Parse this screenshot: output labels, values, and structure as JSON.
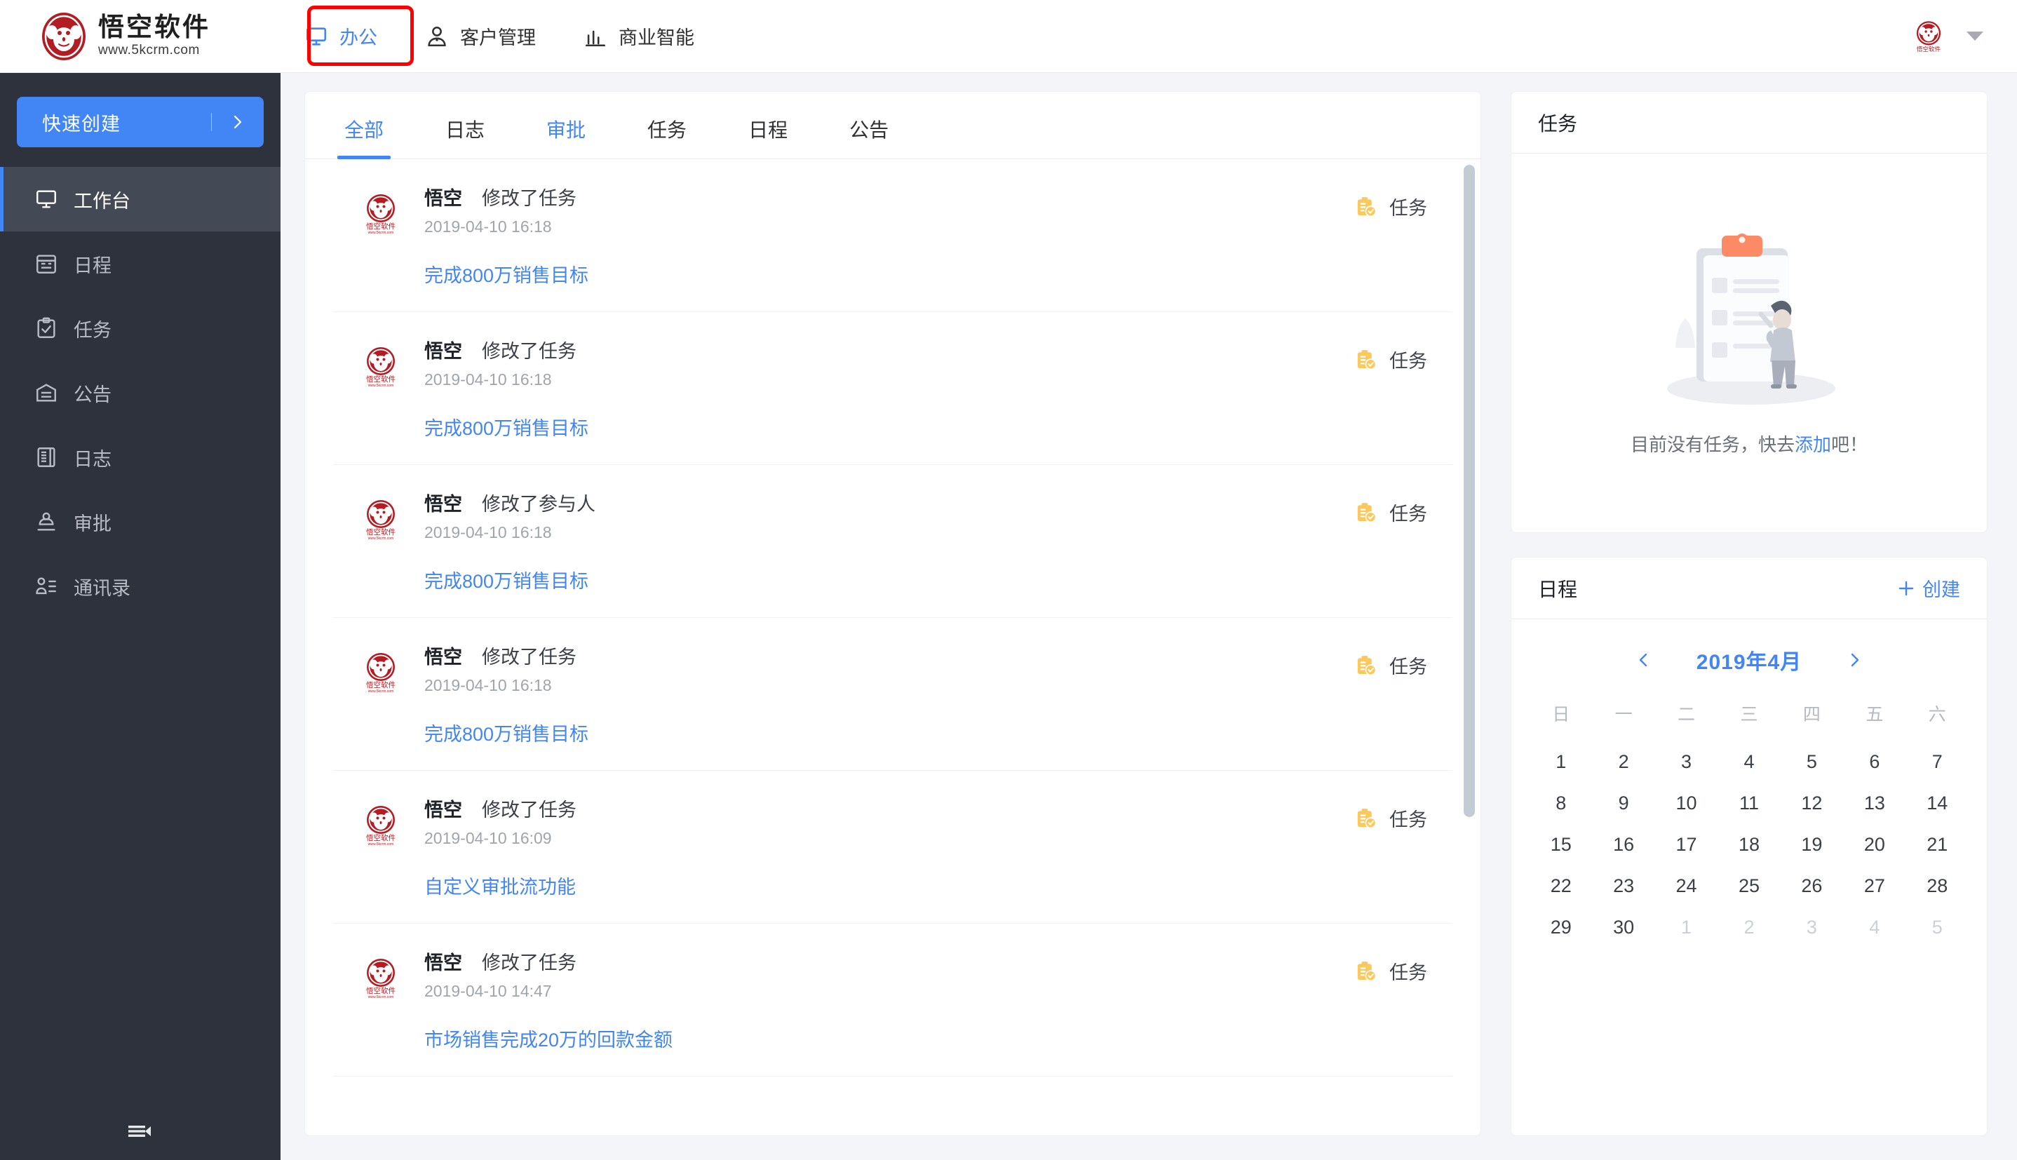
{
  "brand": {
    "name": "悟空软件",
    "url": "www.5kcrm.com",
    "logo_icon": "monkey-logo-icon"
  },
  "topnav": {
    "items": [
      {
        "label": "办公",
        "icon": "monitor-icon",
        "active": true,
        "highlighted": true
      },
      {
        "label": "客户管理",
        "icon": "person-icon",
        "active": false,
        "highlighted": false
      },
      {
        "label": "商业智能",
        "icon": "bar-chart-icon",
        "active": false,
        "highlighted": false
      }
    ],
    "avatar_icon": "user-avatar-icon",
    "caret_icon": "chevron-down-icon"
  },
  "sidebar": {
    "quick_create_label": "快速创建",
    "quick_create_arrow_icon": "chevron-right-icon",
    "collapse_icon": "collapse-menu-icon",
    "items": [
      {
        "label": "工作台",
        "icon": "monitor-icon",
        "active": true
      },
      {
        "label": "日程",
        "icon": "calendar-icon",
        "active": false
      },
      {
        "label": "任务",
        "icon": "clipboard-check-icon",
        "active": false
      },
      {
        "label": "公告",
        "icon": "envelope-icon",
        "active": false
      },
      {
        "label": "日志",
        "icon": "book-icon",
        "active": false
      },
      {
        "label": "审批",
        "icon": "stamp-icon",
        "active": false
      },
      {
        "label": "通讯录",
        "icon": "contacts-icon",
        "active": false
      }
    ]
  },
  "feed": {
    "tabs": [
      {
        "label": "全部",
        "state": "active"
      },
      {
        "label": "日志",
        "state": "normal"
      },
      {
        "label": "审批",
        "state": "hover"
      },
      {
        "label": "任务",
        "state": "normal"
      },
      {
        "label": "日程",
        "state": "normal"
      },
      {
        "label": "公告",
        "state": "normal"
      }
    ],
    "items": [
      {
        "user": "悟空",
        "action": "修改了任务",
        "time": "2019-04-10 16:18",
        "title": "完成800万销售目标",
        "type_label": "任务",
        "type_icon": "clipboard-check-icon",
        "avatar_icon": "monkey-logo-icon"
      },
      {
        "user": "悟空",
        "action": "修改了任务",
        "time": "2019-04-10 16:18",
        "title": "完成800万销售目标",
        "type_label": "任务",
        "type_icon": "clipboard-check-icon",
        "avatar_icon": "monkey-logo-icon"
      },
      {
        "user": "悟空",
        "action": "修改了参与人",
        "time": "2019-04-10 16:18",
        "title": "完成800万销售目标",
        "type_label": "任务",
        "type_icon": "clipboard-check-icon",
        "avatar_icon": "monkey-logo-icon"
      },
      {
        "user": "悟空",
        "action": "修改了任务",
        "time": "2019-04-10 16:18",
        "title": "完成800万销售目标",
        "type_label": "任务",
        "type_icon": "clipboard-check-icon",
        "avatar_icon": "monkey-logo-icon"
      },
      {
        "user": "悟空",
        "action": "修改了任务",
        "time": "2019-04-10 16:09",
        "title": "自定义审批流功能",
        "type_label": "任务",
        "type_icon": "clipboard-check-icon",
        "avatar_icon": "monkey-logo-icon"
      },
      {
        "user": "悟空",
        "action": "修改了任务",
        "time": "2019-04-10 14:47",
        "title": "市场销售完成20万的回款金额",
        "type_label": "任务",
        "type_icon": "clipboard-check-icon",
        "avatar_icon": "monkey-logo-icon"
      }
    ]
  },
  "task_panel": {
    "title": "任务",
    "empty_text_before": "目前没有任务，快去",
    "empty_link": "添加",
    "empty_text_after": "吧！",
    "illustration_icon": "empty-task-illustration-icon"
  },
  "schedule_panel": {
    "title": "日程",
    "create_label": "创建",
    "create_icon": "plus-icon",
    "prev_icon": "chevron-left-icon",
    "next_icon": "chevron-right-icon",
    "month_label": "2019年4月",
    "weekdays": [
      "日",
      "一",
      "二",
      "三",
      "四",
      "五",
      "六"
    ],
    "days": [
      {
        "d": "1",
        "muted": false
      },
      {
        "d": "2",
        "muted": false
      },
      {
        "d": "3",
        "muted": false
      },
      {
        "d": "4",
        "muted": false
      },
      {
        "d": "5",
        "muted": false
      },
      {
        "d": "6",
        "muted": false
      },
      {
        "d": "7",
        "muted": false
      },
      {
        "d": "8",
        "muted": false
      },
      {
        "d": "9",
        "muted": false
      },
      {
        "d": "10",
        "muted": false
      },
      {
        "d": "11",
        "muted": false
      },
      {
        "d": "12",
        "muted": false
      },
      {
        "d": "13",
        "muted": false
      },
      {
        "d": "14",
        "muted": false
      },
      {
        "d": "15",
        "muted": false
      },
      {
        "d": "16",
        "muted": false
      },
      {
        "d": "17",
        "muted": false
      },
      {
        "d": "18",
        "muted": false
      },
      {
        "d": "19",
        "muted": false
      },
      {
        "d": "20",
        "muted": false
      },
      {
        "d": "21",
        "muted": false
      },
      {
        "d": "22",
        "muted": false
      },
      {
        "d": "23",
        "muted": false
      },
      {
        "d": "24",
        "muted": false
      },
      {
        "d": "25",
        "muted": false
      },
      {
        "d": "26",
        "muted": false
      },
      {
        "d": "27",
        "muted": false
      },
      {
        "d": "28",
        "muted": false
      },
      {
        "d": "29",
        "muted": false
      },
      {
        "d": "30",
        "muted": false
      },
      {
        "d": "1",
        "muted": true
      },
      {
        "d": "2",
        "muted": true
      },
      {
        "d": "3",
        "muted": true
      },
      {
        "d": "4",
        "muted": true
      },
      {
        "d": "5",
        "muted": true
      }
    ]
  },
  "colors": {
    "accent": "#4285f4",
    "sidebar_bg": "#2e323d",
    "sidebar_active_bg": "#434a55",
    "page_bg": "#f4f5f9",
    "task_badge": "#fbc85d",
    "annotation": "#ff0000",
    "logo_red": "#b41c23"
  }
}
